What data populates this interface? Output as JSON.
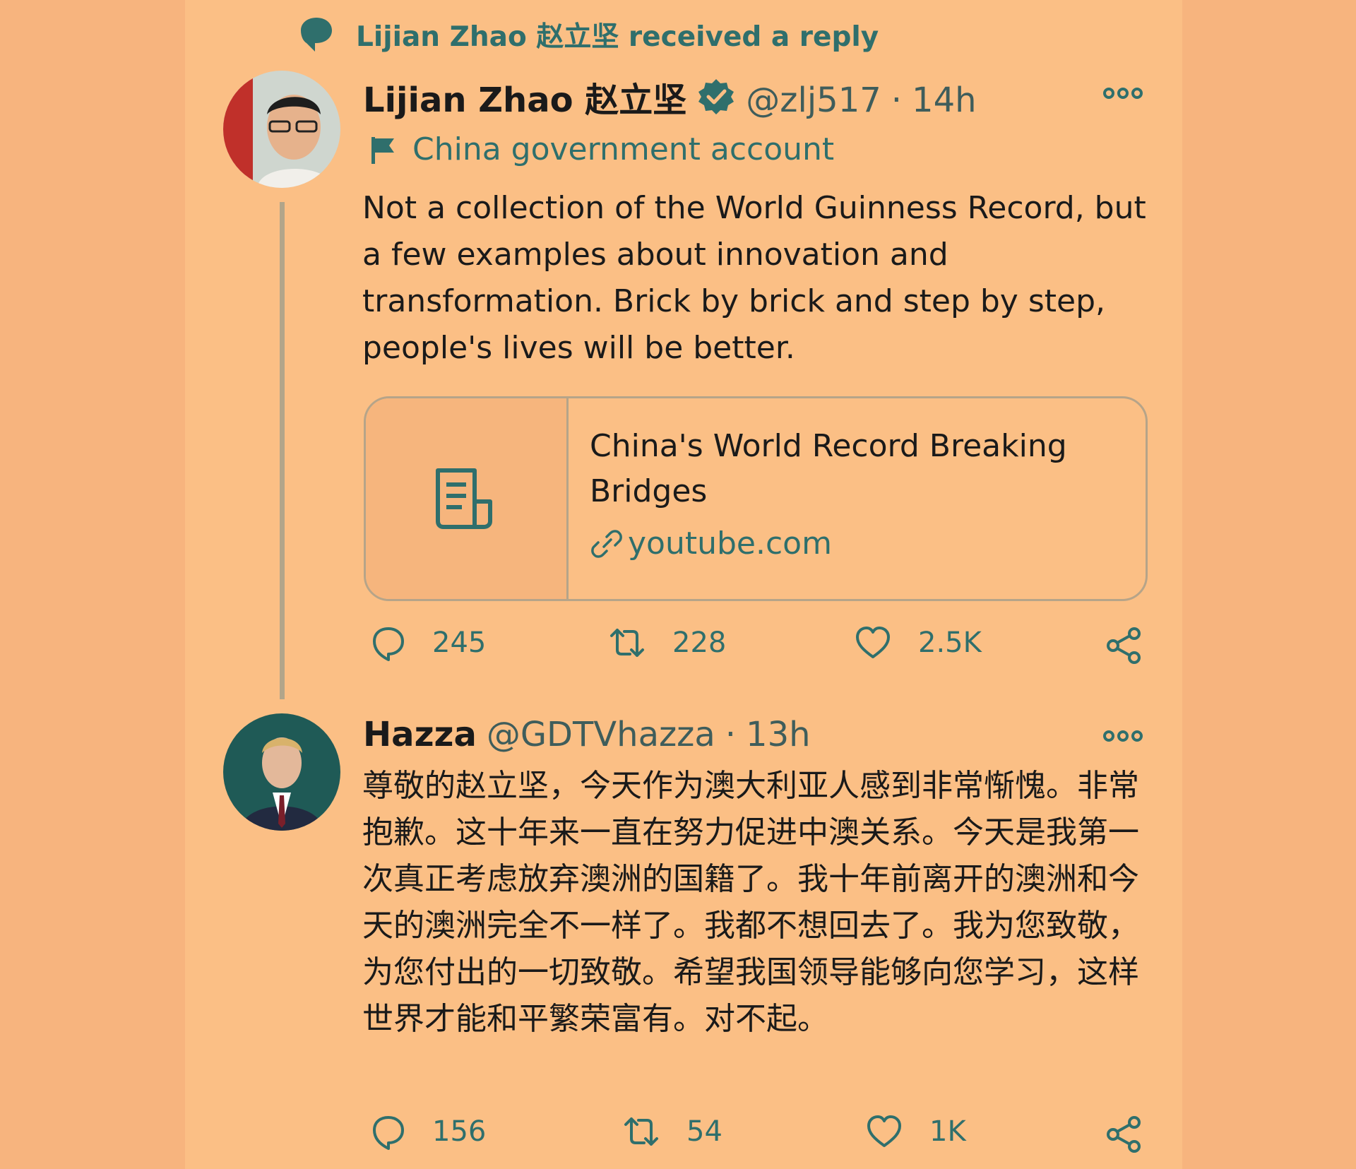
{
  "notice": {
    "text": "Lijian Zhao 赵立坚 received a reply"
  },
  "tweet1": {
    "name": "Lijian Zhao 赵立坚",
    "handle": "@zlj517",
    "dot": "·",
    "time": "14h",
    "label": "China government account",
    "text": "Not a collection of the World Guinness Record, but a few examples about innovation and transformation. Brick by brick and step by step, people's lives will be better.",
    "card": {
      "title": "China's World Record Breaking Bridges",
      "domain": "youtube.com"
    },
    "replies": "245",
    "retweets": "228",
    "likes": "2.5K"
  },
  "tweet2": {
    "name": "Hazza",
    "handle": "@GDTVhazza",
    "dot": "·",
    "time": "13h",
    "text": "尊敬的赵立坚，今天作为澳大利亚人感到非常惭愧。非常抱歉。这十年来一直在努力促进中澳关系。今天是我第一次真正考虑放弃澳洲的国籍了。我十年前离开的澳洲和今天的澳洲完全不一样了。我都不想回去了。我为您致敬，为您付出的一切致敬。希望我国领导能够向您学习，这样世界才能和平繁荣富有。对不起。",
    "replies": "156",
    "retweets": "54",
    "likes": "1K"
  },
  "colors": {
    "background": "#fbbf85",
    "accent": "#2f6f6c",
    "text": "#1a1a1a"
  },
  "icons": [
    "speech-bubble-icon",
    "verified-badge-icon",
    "more-options-icon",
    "flag-icon",
    "article-icon",
    "link-icon",
    "reply-icon",
    "retweet-icon",
    "like-icon",
    "share-icon"
  ]
}
